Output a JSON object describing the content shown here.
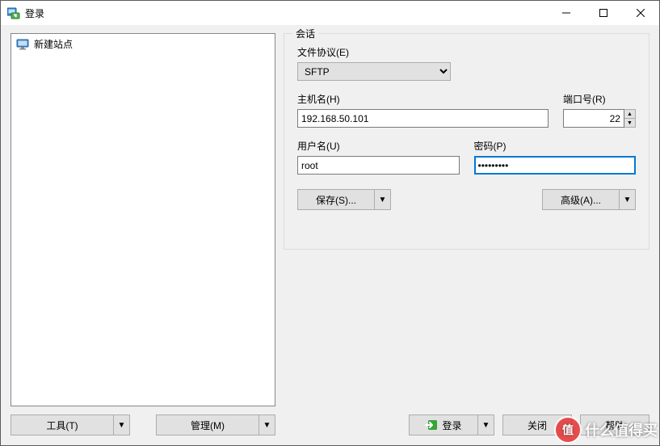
{
  "window": {
    "title": "登录",
    "minimize": "–",
    "maximize": "☐",
    "close": "✕"
  },
  "sidebar": {
    "items": [
      {
        "label": "新建站点"
      }
    ]
  },
  "session": {
    "legend": "会话",
    "protocol_label": "文件协议(E)",
    "protocol_value": "SFTP",
    "host_label": "主机名(H)",
    "host_value": "192.168.50.101",
    "port_label": "端口号(R)",
    "port_value": "22",
    "user_label": "用户名(U)",
    "user_value": "root",
    "pass_label": "密码(P)",
    "pass_value": "•••••••••",
    "save_label": "保存(S)...",
    "advanced_label": "高级(A)...",
    "drop_glyph": "▼",
    "spin_up": "▲",
    "spin_down": "▼"
  },
  "footer_left": {
    "tools_label": "工具(T)",
    "manage_label": "管理(M)",
    "drop_glyph": "▼"
  },
  "footer_right": {
    "login_label": "登录",
    "close_label": "关闭",
    "help_label": "帮助",
    "drop_glyph": "▼"
  },
  "watermark": {
    "logo_char": "值",
    "text": "什么值得买"
  }
}
